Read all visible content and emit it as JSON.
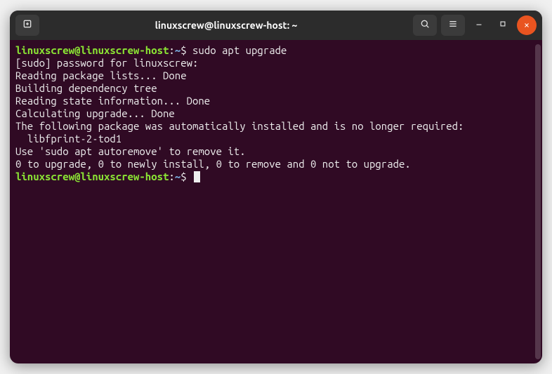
{
  "titlebar": {
    "title": "linuxscrew@linuxscrew-host: ~"
  },
  "terminal": {
    "prompt": {
      "userhost": "linuxscrew@linuxscrew-host",
      "path": "~",
      "symbol": "$"
    },
    "command1": "sudo apt upgrade",
    "output_lines": [
      "[sudo] password for linuxscrew:",
      "Reading package lists... Done",
      "Building dependency tree",
      "Reading state information... Done",
      "Calculating upgrade... Done",
      "The following package was automatically installed and is no longer required:",
      "  libfprint-2-tod1",
      "Use 'sudo apt autoremove' to remove it.",
      "0 to upgrade, 0 to newly install, 0 to remove and 0 not to upgrade."
    ]
  }
}
